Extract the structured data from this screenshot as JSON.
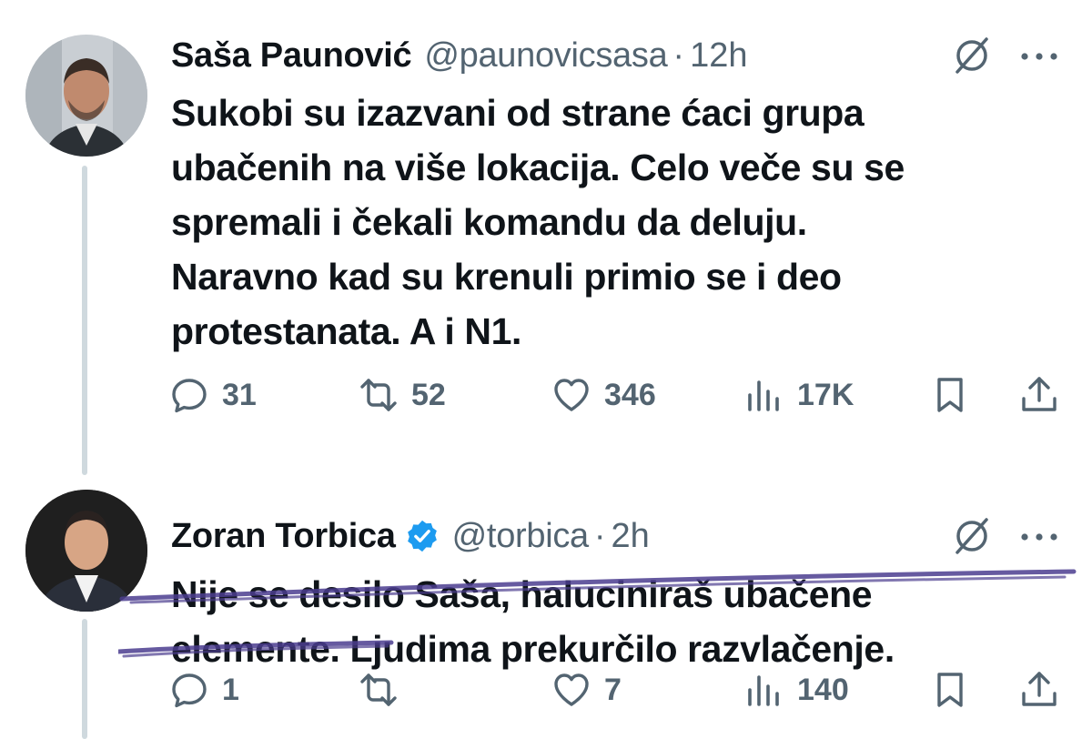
{
  "tweets": [
    {
      "author": {
        "display_name": "Saša Paunović",
        "handle": "@paunovicsasa",
        "separator": "·",
        "time": "12h",
        "verified": false
      },
      "text": "Sukobi su izazvani od strane ćaci grupa\nubačenih na više lokacija. Celo veče su se\nspremali i čekali komandu da deluju.\nNaravno kad su krenuli primio se i deo\nprotestanata. A i N1.",
      "stats": {
        "replies": "31",
        "reposts": "52",
        "likes": "346",
        "views": "17K"
      }
    },
    {
      "author": {
        "display_name": "Zoran Torbica",
        "handle": "@torbica",
        "separator": "·",
        "time": "2h",
        "verified": true
      },
      "text": "Nije se desilo Saša, haluciniraš ubačene\nelemente. Ljudima prekurčilo razvlačenje.",
      "stats": {
        "replies": "1",
        "reposts": "",
        "likes": "7",
        "views": "140"
      }
    }
  ],
  "icons": {
    "reply": "reply-icon",
    "repost": "repost-icon",
    "like": "like-icon",
    "views": "views-icon",
    "bookmark": "bookmark-icon",
    "share": "share-icon",
    "grok": "grok-icon",
    "more": "more-icon"
  },
  "colors": {
    "text": "#0f1419",
    "secondary": "#536471",
    "verified": "#1d9bf0",
    "thread_line": "#cfd9de",
    "underline_marker": "#4b3d8f"
  }
}
